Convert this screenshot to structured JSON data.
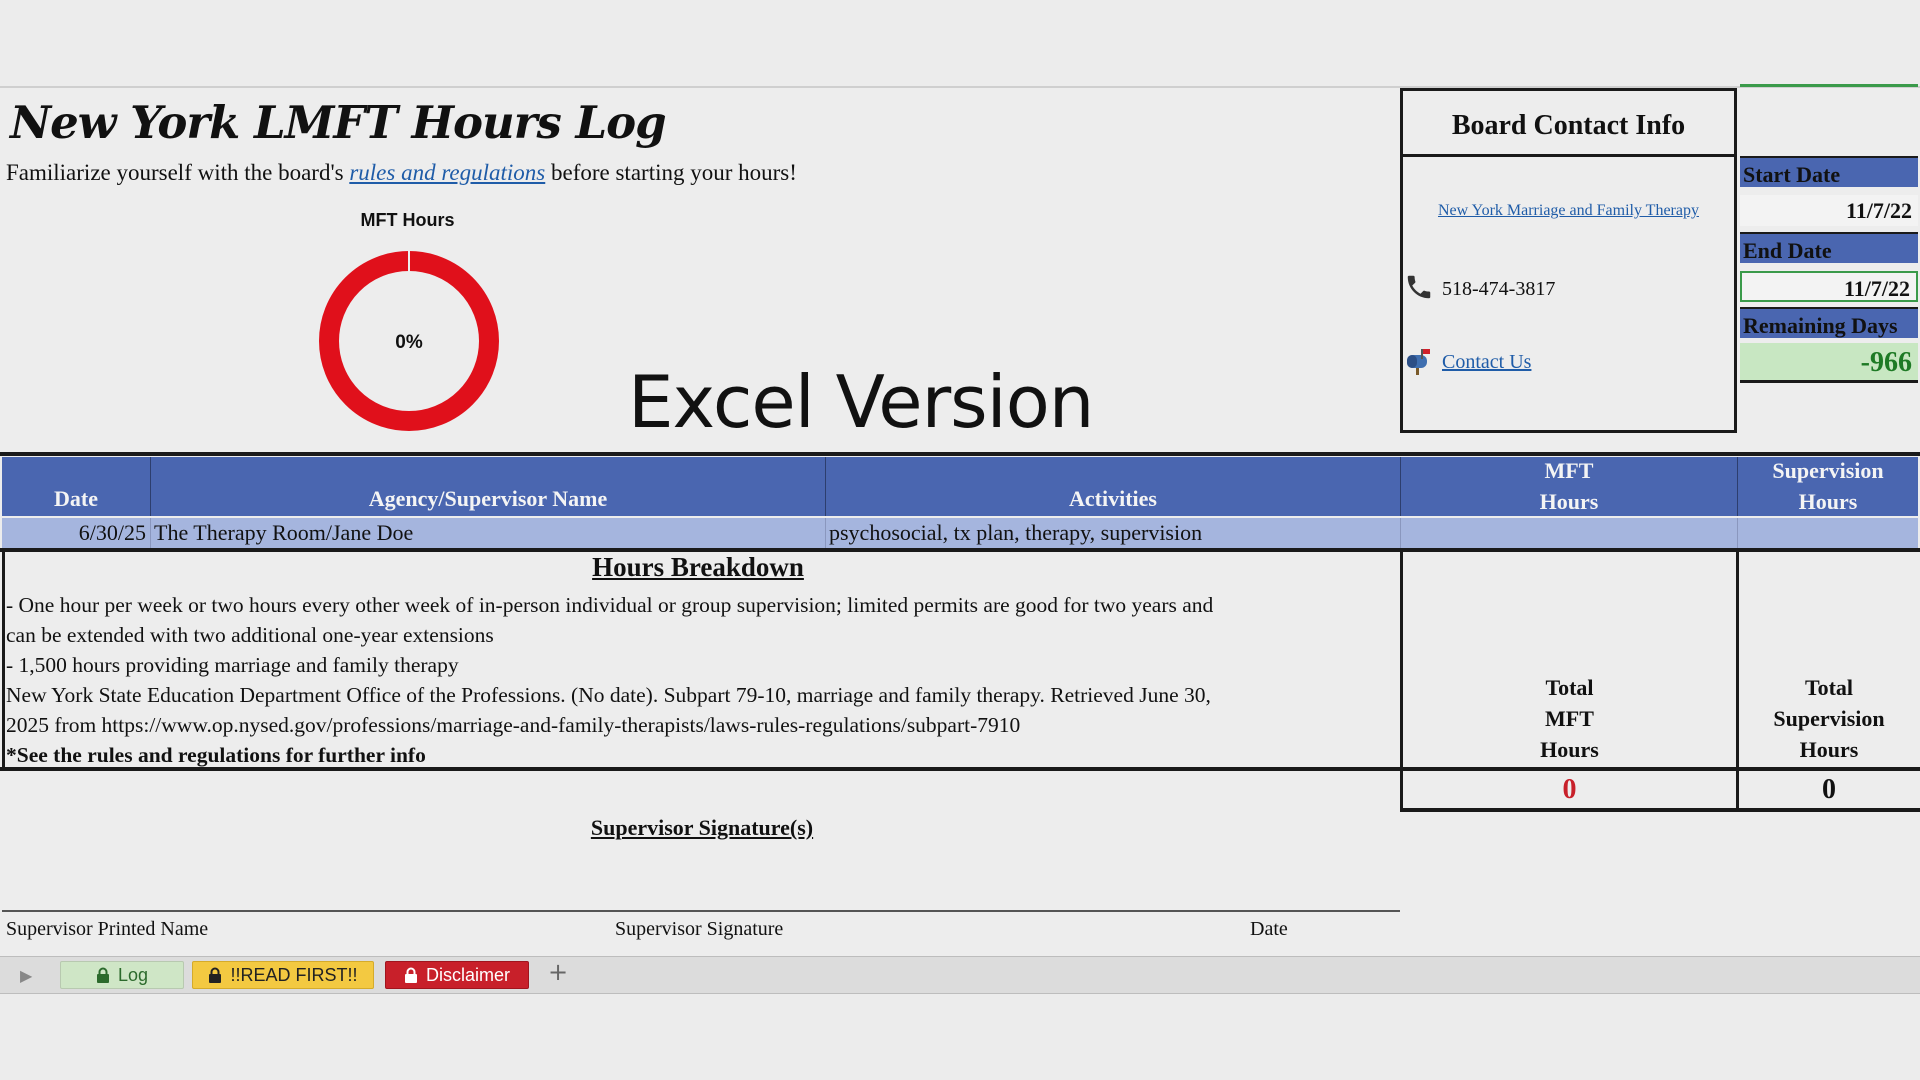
{
  "title": "New York LMFT Hours Log",
  "intro": {
    "before": "Familiarize yourself with the board's ",
    "link": "rules and regulations",
    "after": " before starting your hours!"
  },
  "progress_chart": {
    "title": "MFT Hours",
    "percent_label": "0%",
    "completed_fraction": 0.0,
    "colors": {
      "remaining": "#e0101b",
      "completed": "#4a66b0"
    }
  },
  "overlay_caption": "Excel Version",
  "board_contact": {
    "title": "Board Contact Info",
    "board_link": "New York Marriage and Family Therapy",
    "phone": "518-474-3817",
    "contact_link": "Contact Us"
  },
  "dates": {
    "start_label": "Start Date",
    "start_value": "11/7/22",
    "end_label": "End Date",
    "end_value": "11/7/22",
    "remaining_label": "Remaining Days",
    "remaining_value": "-966"
  },
  "log_table": {
    "headers": {
      "date": "Date",
      "agency": "Agency/Supervisor Name",
      "activities": "Activities",
      "mft_line1": "MFT",
      "mft_line2": "Hours",
      "sup_line1": "Supervision",
      "sup_line2": "Hours"
    },
    "rows": [
      {
        "date": "6/30/25",
        "agency": "The Therapy Room/Jane Doe",
        "activities": "psychosocial, tx plan, therapy, supervision",
        "mft_hours": "",
        "supervision_hours": ""
      }
    ]
  },
  "hours_breakdown": {
    "title": "Hours Breakdown",
    "lines": [
      "- One hour per week or two hours every other week of in-person individual or group supervision; limited permits are good for two years and",
      "can be extended with two additional one-year extensions",
      "- 1,500 hours providing marriage and family therapy",
      "New York State Education Department Office of the Professions. (No date). Subpart 79-10, marriage and family therapy. Retrieved June 30,",
      "2025 from https://www.op.nysed.gov/professions/marriage-and-family-therapists/laws-rules-regulations/subpart-7910"
    ],
    "note": "*See the rules and regulations for further info"
  },
  "totals": {
    "mft_label": [
      "Total",
      "MFT",
      "Hours"
    ],
    "mft_value": "0",
    "sup_label": [
      "Total",
      "Supervision",
      "Hours"
    ],
    "sup_value": "0",
    "colors": {
      "mft_value": "#c8202a",
      "sup_value": "#111111"
    }
  },
  "signatures": {
    "title": "Supervisor Signature(s)",
    "printed_name": "Supervisor Printed Name",
    "signature": "Supervisor Signature",
    "date": "Date"
  },
  "sheet_tabs": {
    "log": "Log",
    "read_first": "!!READ FIRST!!",
    "disclaimer": "Disclaimer",
    "add": "+"
  },
  "icons": {
    "phone": "phone-icon",
    "contact": "mailbox-icon",
    "tab_lock": "lock-icon",
    "scroll": "play-right-icon"
  }
}
